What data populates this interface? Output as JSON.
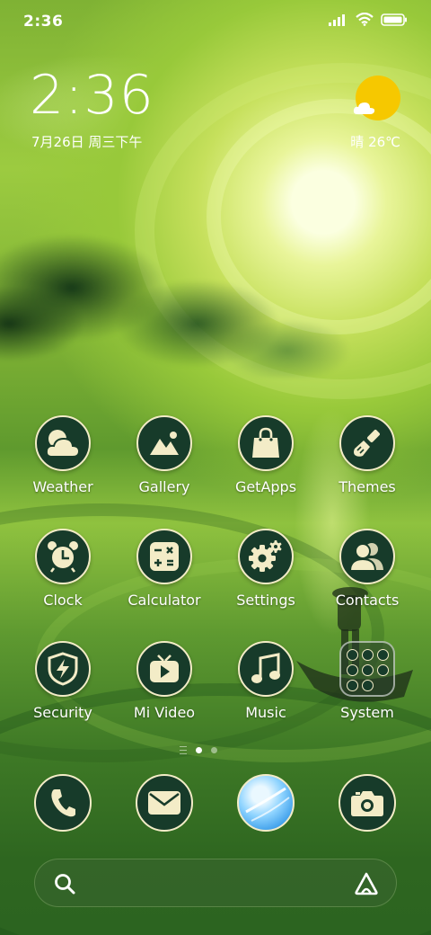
{
  "status_bar": {
    "time": "2:36",
    "icons": [
      "signal-icon",
      "wifi-icon",
      "battery-icon"
    ]
  },
  "clock_widget": {
    "time": "2:36",
    "date": "7月26日 周三下午"
  },
  "weather_widget": {
    "icon": "sun-cloud-icon",
    "text": "晴 26℃"
  },
  "apps": [
    {
      "label": "Weather",
      "icon": "weather-icon"
    },
    {
      "label": "Gallery",
      "icon": "gallery-icon"
    },
    {
      "label": "GetApps",
      "icon": "shopping-bag-icon"
    },
    {
      "label": "Themes",
      "icon": "paintbrush-icon"
    },
    {
      "label": "Clock",
      "icon": "alarm-clock-icon"
    },
    {
      "label": "Calculator",
      "icon": "calculator-icon"
    },
    {
      "label": "Settings",
      "icon": "gear-icon"
    },
    {
      "label": "Contacts",
      "icon": "contacts-icon"
    },
    {
      "label": "Security",
      "icon": "shield-bolt-icon"
    },
    {
      "label": "Mi Video",
      "icon": "tv-play-icon"
    },
    {
      "label": "Music",
      "icon": "music-note-icon"
    },
    {
      "label": "System",
      "icon": "folder-icon"
    }
  ],
  "pager": {
    "pages": 2,
    "active": 1
  },
  "dock": [
    {
      "name": "Phone",
      "icon": "phone-icon"
    },
    {
      "name": "Messages",
      "icon": "envelope-icon"
    },
    {
      "name": "Browser",
      "icon": "browser-icon"
    },
    {
      "name": "Camera",
      "icon": "camera-icon"
    }
  ],
  "search_bar": {
    "left_icon": "search-icon",
    "right_icon": "assistant-icon"
  },
  "colors": {
    "icon_bg": "#173b2a",
    "icon_fg": "#f3ecc7",
    "sun": "#f6c800"
  }
}
